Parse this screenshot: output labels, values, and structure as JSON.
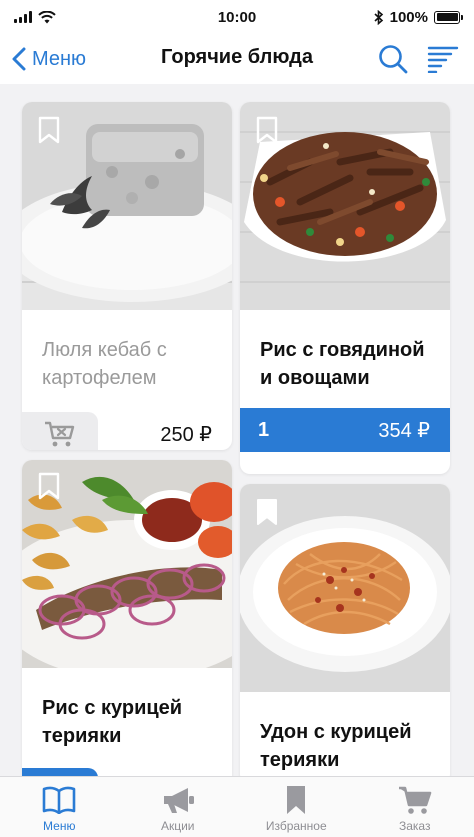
{
  "status_bar": {
    "time": "10:00",
    "battery": "100%"
  },
  "nav": {
    "back_label": "Меню",
    "title": "Горячие блюда"
  },
  "cards": [
    {
      "title": "Люля кебаб с картофелем",
      "price": "250 ₽",
      "available": false,
      "image": "kebab-with-potatoes"
    },
    {
      "title": "Рис с говядиной и овощами",
      "price": "354 ₽",
      "quantity": "1",
      "available": true,
      "image": "rice-with-beef"
    },
    {
      "title": "Рис с курицей терияки",
      "available": true,
      "image": "kebab-with-onion"
    },
    {
      "title": "Удон с курицей терияки",
      "available": true,
      "image": "spaghetti"
    }
  ],
  "tabs": [
    {
      "label": "Меню",
      "icon": "book-icon",
      "active": true
    },
    {
      "label": "Акции",
      "icon": "megaphone-icon",
      "active": false
    },
    {
      "label": "Избранное",
      "icon": "bookmark-icon",
      "active": false
    },
    {
      "label": "Заказ",
      "icon": "cart-icon",
      "active": false
    }
  ],
  "colors": {
    "accent": "#2a7bd4",
    "inactive": "#8e8e93",
    "background": "#f2f2f4"
  }
}
